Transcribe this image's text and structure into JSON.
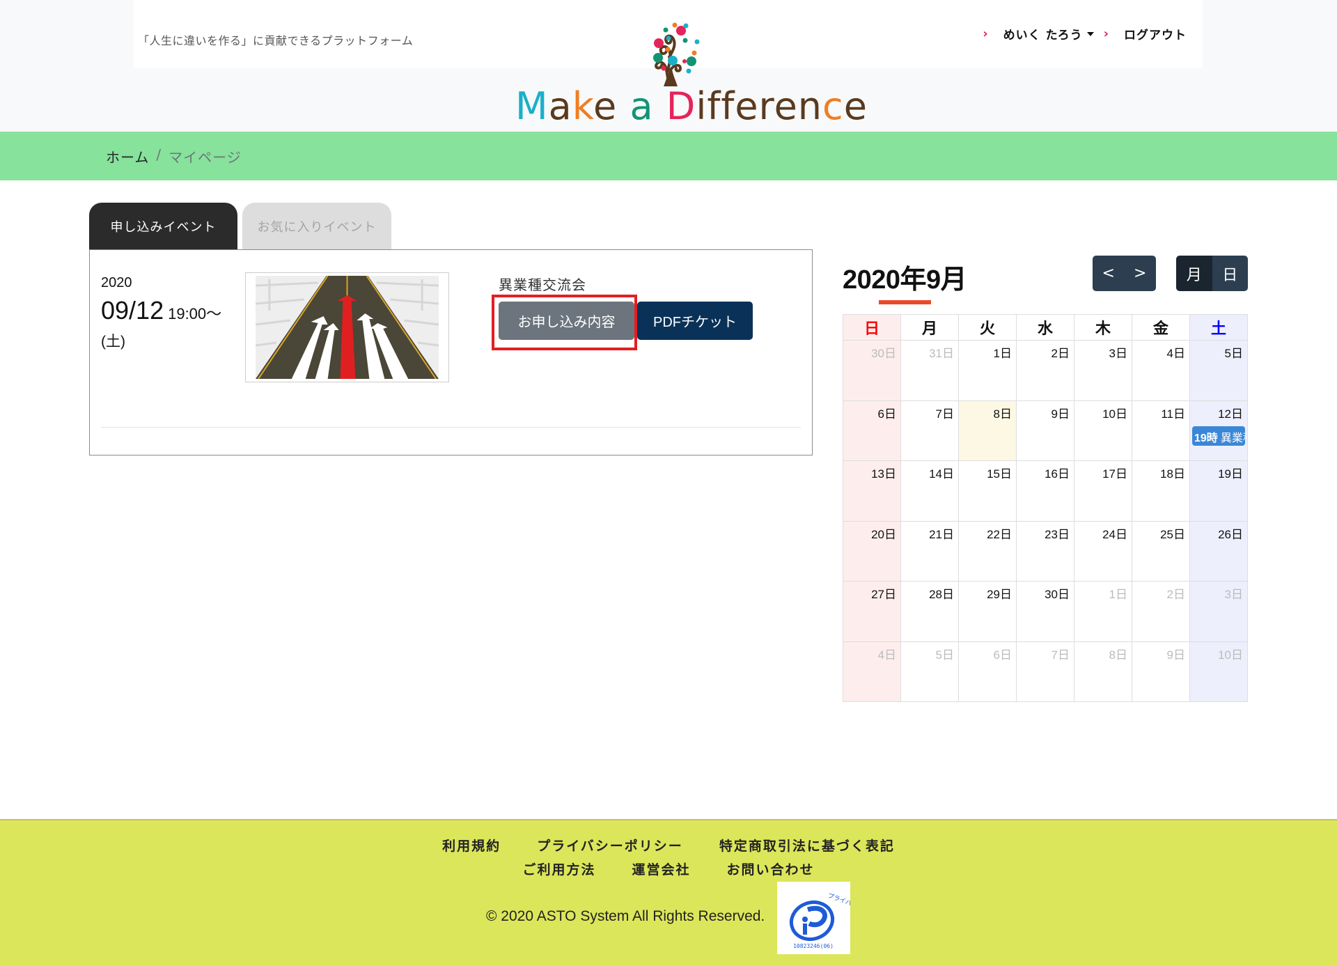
{
  "header": {
    "tagline": "「人生に違いを作る」に貢献できるプラットフォーム",
    "logo_parts": [
      "M",
      "a",
      "k",
      "e",
      " ",
      "a",
      " ",
      "D",
      "ifferen",
      "c",
      "e"
    ],
    "logo_alt": "Make a Difference",
    "user_name": "めいく たろう",
    "logout_label": "ログアウト"
  },
  "breadcrumb": {
    "home": "ホーム",
    "separator": "/",
    "current": "マイページ"
  },
  "tabs": [
    {
      "label": "申し込みイベント",
      "active": true
    },
    {
      "label": "お気に入りイベント",
      "active": false
    }
  ],
  "event": {
    "year": "2020",
    "date": "09/12",
    "time": "19:00～",
    "weekday": "(土)",
    "title": "異業種交流会",
    "detail_button": "お申し込み内容",
    "pdf_button": "PDFチケット"
  },
  "calendar": {
    "title": "2020年9月",
    "prev_label": "<",
    "next_label": ">",
    "view_month": "月",
    "view_day": "日",
    "weekdays": [
      "日",
      "月",
      "火",
      "水",
      "木",
      "金",
      "土"
    ],
    "day_suffix": "日",
    "weeks": [
      [
        {
          "d": "30",
          "o": true
        },
        {
          "d": "31",
          "o": true
        },
        {
          "d": "1"
        },
        {
          "d": "2"
        },
        {
          "d": "3"
        },
        {
          "d": "4"
        },
        {
          "d": "5"
        }
      ],
      [
        {
          "d": "6"
        },
        {
          "d": "7"
        },
        {
          "d": "8",
          "today": true
        },
        {
          "d": "9"
        },
        {
          "d": "10"
        },
        {
          "d": "11"
        },
        {
          "d": "12",
          "event": {
            "time": "19時",
            "title": "異業種交流会"
          }
        }
      ],
      [
        {
          "d": "13"
        },
        {
          "d": "14"
        },
        {
          "d": "15"
        },
        {
          "d": "16"
        },
        {
          "d": "17"
        },
        {
          "d": "18"
        },
        {
          "d": "19"
        }
      ],
      [
        {
          "d": "20"
        },
        {
          "d": "21"
        },
        {
          "d": "22"
        },
        {
          "d": "23"
        },
        {
          "d": "24"
        },
        {
          "d": "25"
        },
        {
          "d": "26"
        }
      ],
      [
        {
          "d": "27"
        },
        {
          "d": "28"
        },
        {
          "d": "29"
        },
        {
          "d": "30"
        },
        {
          "d": "1",
          "o": true
        },
        {
          "d": "2",
          "o": true
        },
        {
          "d": "3",
          "o": true
        }
      ],
      [
        {
          "d": "4",
          "o": true
        },
        {
          "d": "5",
          "o": true
        },
        {
          "d": "6",
          "o": true
        },
        {
          "d": "7",
          "o": true
        },
        {
          "d": "8",
          "o": true
        },
        {
          "d": "9",
          "o": true
        },
        {
          "d": "10",
          "o": true
        }
      ]
    ]
  },
  "footer": {
    "links_row1": [
      "利用規約",
      "プライバシーポリシー",
      "特定商取引法に基づく表記"
    ],
    "links_row2": [
      "ご利用方法",
      "運営会社",
      "お問い合わせ"
    ],
    "copyright": "© 2020 ASTO System All Rights Reserved.",
    "privacy_mark_text": "たいせつにしますプライバシー",
    "privacy_mark_number": "10823246(06)"
  },
  "colors": {
    "breadcrumb_bar": "#87e29b",
    "footer_bg": "#dce65a",
    "highlight": "#e31e24",
    "pdf_button": "#0a3258",
    "event_badge": "#3a87d8"
  }
}
